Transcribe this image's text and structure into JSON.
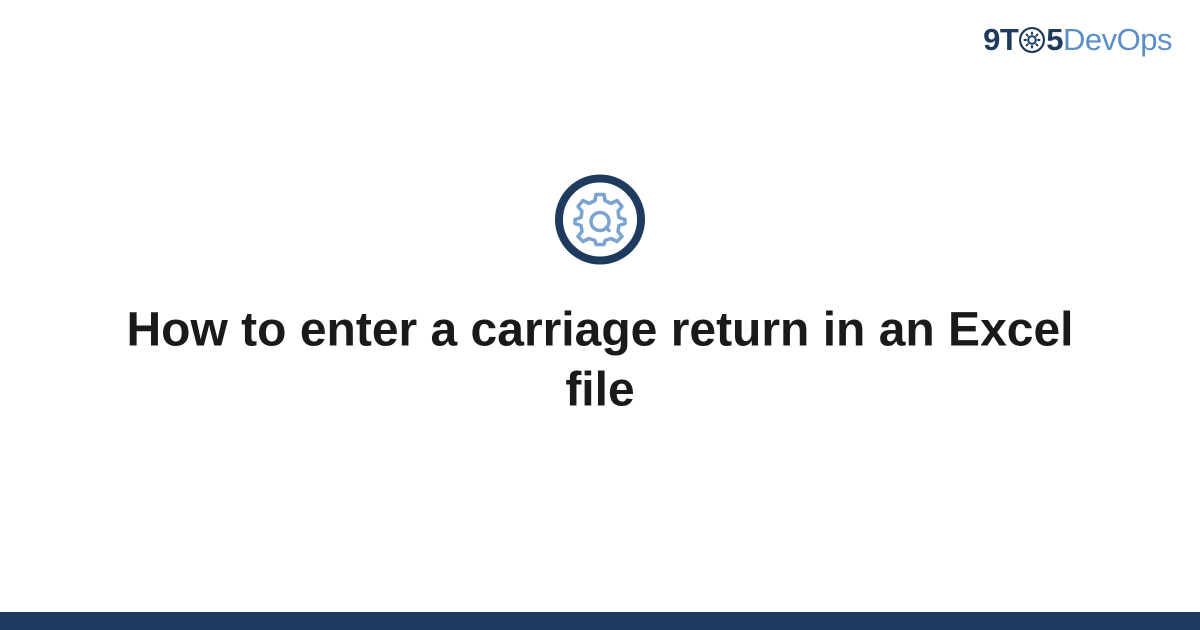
{
  "logo": {
    "part1": "9T",
    "part2": "5",
    "part3": "DevOps"
  },
  "title": "How to enter a carriage return in an Excel file",
  "colors": {
    "dark_blue": "#1e3a5f",
    "light_blue": "#5a8fc7",
    "icon_blue": "#7ba3d0"
  }
}
